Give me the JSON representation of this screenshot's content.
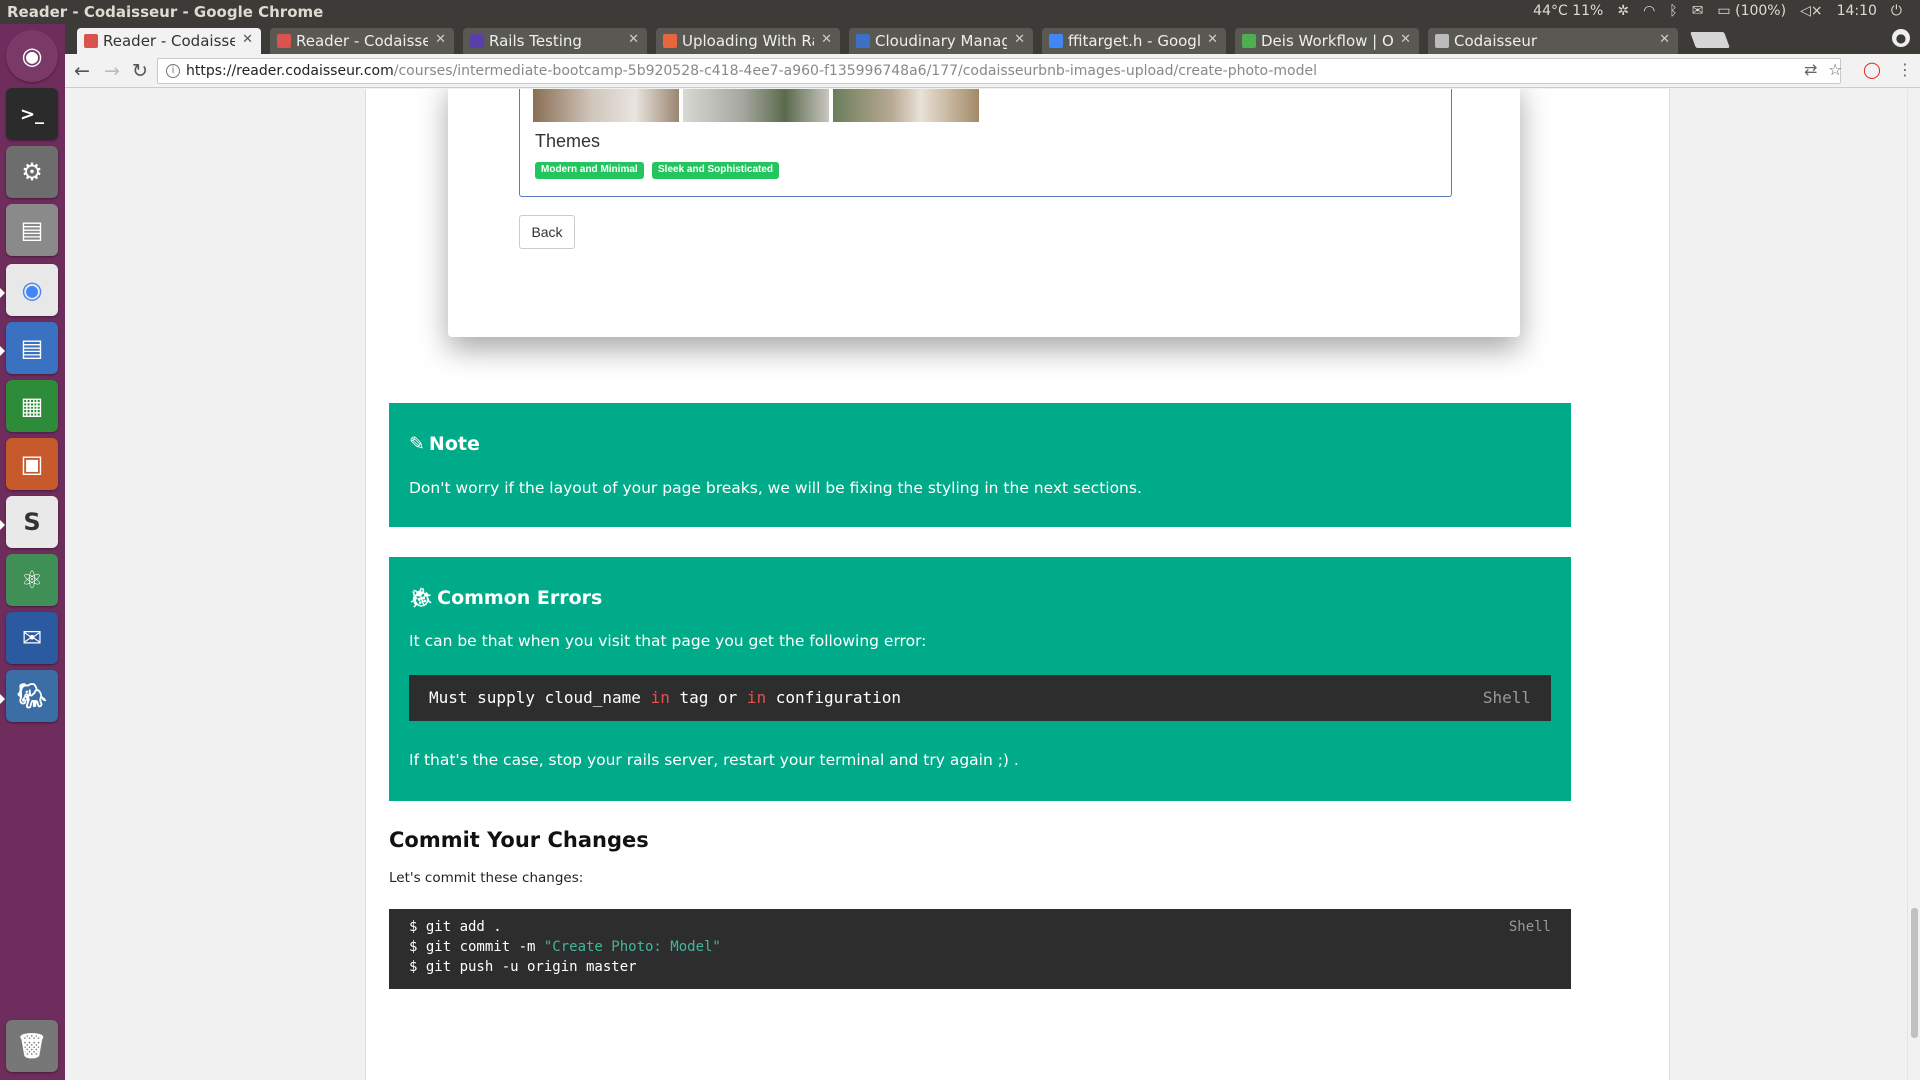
{
  "window": {
    "title": "Reader - Codaisseur - Google Chrome"
  },
  "tray": {
    "temp": "44°C 11%",
    "battery": "(100%)",
    "clock": "14:10"
  },
  "tabs": [
    {
      "label": "Reader - Codaisseur",
      "active": true,
      "favicon_color": "#d9534f"
    },
    {
      "label": "Reader - Codaisseur",
      "active": false,
      "favicon_color": "#d9534f"
    },
    {
      "label": "Rails Testing",
      "active": false,
      "favicon_color": "#5a3fa8"
    },
    {
      "label": "Uploading With Rails",
      "active": false,
      "favicon_color": "#e8663d"
    },
    {
      "label": "Cloudinary Management",
      "active": false,
      "favicon_color": "#3b6fc8"
    },
    {
      "label": "ffitarget.h - Google",
      "active": false,
      "favicon_color": "#4285f4"
    },
    {
      "label": "Deis Workflow | Open",
      "active": false,
      "favicon_color": "#4caf50"
    },
    {
      "label": "Codaisseur",
      "active": false,
      "favicon_color": "#bbbbbb"
    }
  ],
  "address": {
    "host": "https://reader.codaisseur.com",
    "path": "/courses/intermediate-bootcamp-5b920528-c418-4ee7-a960-f135996748a6/177/codaisseurbnb-images-upload/create-photo-model"
  },
  "preview": {
    "themes_title": "Themes",
    "tags": [
      "Modern and Minimal",
      "Sleek and Sophisticated"
    ],
    "back_label": "Back"
  },
  "note": {
    "title": "Note",
    "text": "Don't worry if the layout of your page breaks, we will be fixing the styling in the next sections."
  },
  "errors": {
    "title": "Common Errors",
    "intro": "It can be that when you visit that page you get the following error:",
    "code_parts": [
      "Must supply cloud_name ",
      "in",
      " tag or ",
      "in",
      " configuration"
    ],
    "code_lang": "Shell",
    "outro": "If that's the case, stop your rails server, restart your terminal and try again ;) ."
  },
  "commit": {
    "heading": "Commit Your Changes",
    "text": "Let's commit these changes:",
    "lines": [
      "$ git add .",
      "$ git commit -m ",
      "\"Create Photo: Model\"",
      "$ git push -u origin master"
    ],
    "lang": "Shell"
  }
}
